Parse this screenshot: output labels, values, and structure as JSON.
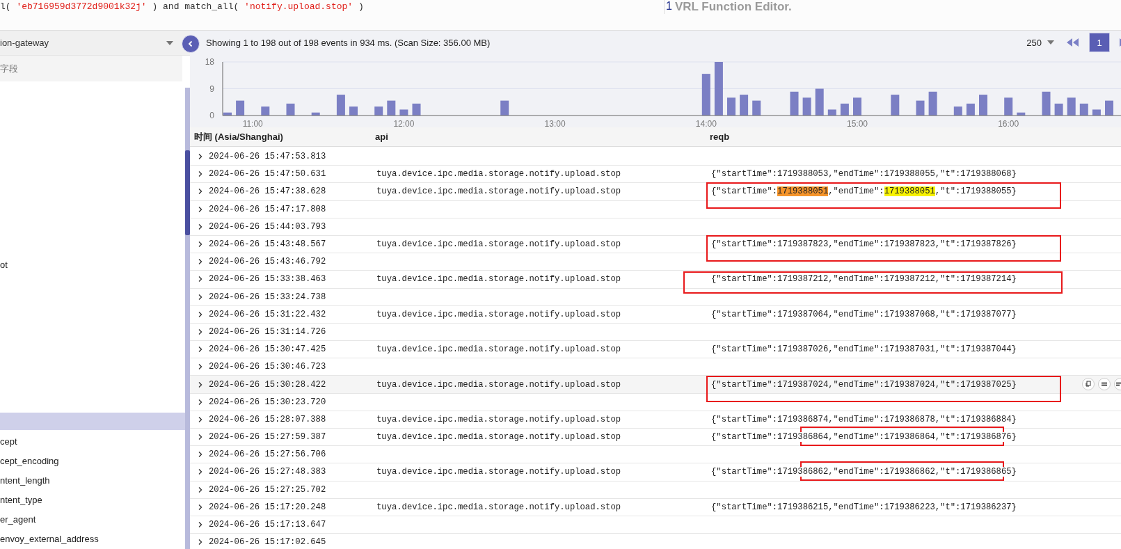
{
  "query_editor": {
    "parts": [
      {
        "kind": "code",
        "text": "l( "
      },
      {
        "kind": "string",
        "text": "'eb716959d3772d9001k32j'"
      },
      {
        "kind": "code",
        "text": " ) and match_all( "
      },
      {
        "kind": "string",
        "text": "'notify.upload.stop'"
      },
      {
        "kind": "code",
        "text": " )"
      }
    ]
  },
  "function_editor": {
    "line_number": "1",
    "text": "VRL Function Editor."
  },
  "sidebar": {
    "stream_select": {
      "value": "ion-gateway"
    },
    "field_search": {
      "placeholder": "字段"
    },
    "fields": [
      {
        "label": "ot",
        "selected": false
      },
      {
        "selected": true
      },
      {
        "label": "cept",
        "selected": false
      },
      {
        "label": "cept_encoding",
        "selected": false
      },
      {
        "label": "ntent_length",
        "selected": false
      },
      {
        "label": "ntent_type",
        "selected": false
      },
      {
        "label": "er_agent",
        "selected": false
      },
      {
        "label": "envoy_external_address",
        "selected": false
      }
    ]
  },
  "results": {
    "summary": "Showing 1 to 198 out of 198 events in 934 ms. (Scan Size: 356.00 MB)",
    "pagination": {
      "page_size": "250",
      "pages": [
        {
          "label": "1",
          "selected": true
        }
      ]
    },
    "histogram": {
      "chart_data": {
        "type": "bar",
        "categories": [
          null,
          null,
          "11:00",
          null,
          null,
          null,
          null,
          null,
          null,
          null,
          null,
          null,
          null,
          null,
          "12:00",
          null,
          null,
          null,
          null,
          null,
          null,
          null,
          null,
          null,
          null,
          null,
          "13:00",
          null,
          null,
          null,
          null,
          null,
          null,
          null,
          null,
          null,
          null,
          null,
          "14:00",
          null,
          null,
          null,
          null,
          null,
          null,
          null,
          null,
          null,
          null,
          null,
          "15:00",
          null,
          null,
          null,
          null,
          null,
          null,
          null,
          null,
          null,
          null,
          null,
          "16:00",
          null,
          null,
          null,
          null,
          null,
          null,
          null,
          null
        ],
        "values": [
          1,
          5,
          0,
          3,
          0,
          4,
          0,
          1,
          0,
          7,
          3,
          0,
          3,
          5,
          2,
          4,
          0,
          0,
          0,
          0,
          0,
          0,
          5,
          0,
          0,
          0,
          0,
          0,
          0,
          0,
          0,
          0,
          0,
          0,
          0,
          0,
          0,
          0,
          14,
          18,
          6,
          7,
          5,
          0,
          0,
          8,
          6,
          9,
          2,
          4,
          6,
          0,
          0,
          7,
          0,
          5,
          8,
          0,
          3,
          4,
          7,
          0,
          6,
          1,
          0,
          8,
          4,
          6,
          4,
          2,
          5
        ],
        "ylim": [
          0,
          18
        ],
        "yticks": [
          0,
          9,
          18
        ]
      }
    },
    "table": {
      "columns": [
        "时间 (Asia/Shanghai)",
        "api",
        "reqb"
      ],
      "rows": [
        {
          "time": "2024-06-26 15:47:53.813"
        },
        {
          "time": "2024-06-26 15:47:50.631",
          "api": "tuya.device.ipc.media.storage.notify.upload.stop",
          "reqb": "{\"startTime\":1719388053,\"endTime\":1719388055,\"t\":1719388068}"
        },
        {
          "time": "2024-06-26 15:47:38.628",
          "api": "tuya.device.ipc.media.storage.notify.upload.stop",
          "reqb_parts": [
            {
              "text": "{\"startTime\":"
            },
            {
              "text": "1719388051",
              "color": "#f5942a"
            },
            {
              "text": ",\"endTime\":"
            },
            {
              "text": "1719388051",
              "color": "#f7f200"
            },
            {
              "text": ",\"t\":1719388055}"
            }
          ],
          "annotation_box": {
            "kind": "full"
          }
        },
        {
          "time": "2024-06-26 15:47:17.808"
        },
        {
          "time": "2024-06-26 15:44:03.793"
        },
        {
          "time": "2024-06-26 15:43:48.567",
          "api": "tuya.device.ipc.media.storage.notify.upload.stop",
          "reqb": "{\"startTime\":1719387823,\"endTime\":1719387823,\"t\":1719387826}",
          "annotation_box": {
            "kind": "full"
          }
        },
        {
          "time": "2024-06-26 15:43:46.792"
        },
        {
          "time": "2024-06-26 15:33:38.463",
          "api": "tuya.device.ipc.media.storage.notify.upload.stop",
          "reqb": "{\"startTime\":1719387212,\"endTime\":1719387212,\"t\":1719387214}",
          "annotation_box": {
            "kind": "wide"
          }
        },
        {
          "time": "2024-06-26 15:33:24.738"
        },
        {
          "time": "2024-06-26 15:31:22.432",
          "api": "tuya.device.ipc.media.storage.notify.upload.stop",
          "reqb": "{\"startTime\":1719387064,\"endTime\":1719387068,\"t\":1719387077}"
        },
        {
          "time": "2024-06-26 15:31:14.726"
        },
        {
          "time": "2024-06-26 15:30:47.425",
          "api": "tuya.device.ipc.media.storage.notify.upload.stop",
          "reqb": "{\"startTime\":1719387026,\"endTime\":1719387031,\"t\":1719387044}"
        },
        {
          "time": "2024-06-26 15:30:46.723"
        },
        {
          "time": "2024-06-26 15:30:28.422",
          "api": "tuya.device.ipc.media.storage.notify.upload.stop",
          "reqb": "{\"startTime\":1719387024,\"endTime\":1719387024,\"t\":1719387025}",
          "annotation_box": {
            "kind": "full"
          },
          "hovered": true
        },
        {
          "time": "2024-06-26 15:30:23.720"
        },
        {
          "time": "2024-06-26 15:28:07.388",
          "api": "tuya.device.ipc.media.storage.notify.upload.stop",
          "reqb": "{\"startTime\":1719386874,\"endTime\":1719386878,\"t\":1719386884}"
        },
        {
          "time": "2024-06-26 15:27:59.387",
          "api": "tuya.device.ipc.media.storage.notify.upload.stop",
          "reqb": "{\"startTime\":1719386864,\"endTime\":1719386864,\"t\":1719386876}",
          "annotation_box": {
            "kind": "partial"
          }
        },
        {
          "time": "2024-06-26 15:27:56.706"
        },
        {
          "time": "2024-06-26 15:27:48.383",
          "api": "tuya.device.ipc.media.storage.notify.upload.stop",
          "reqb": "{\"startTime\":1719386862,\"endTime\":1719386862,\"t\":1719386865}",
          "annotation_box": {
            "kind": "partial"
          }
        },
        {
          "time": "2024-06-26 15:27:25.702"
        },
        {
          "time": "2024-06-26 15:17:20.248",
          "api": "tuya.device.ipc.media.storage.notify.upload.stop",
          "reqb": "{\"startTime\":1719386215,\"endTime\":1719386223,\"t\":1719386237}"
        },
        {
          "time": "2024-06-26 15:17:13.647"
        },
        {
          "time": "2024-06-26 15:17:02.645"
        }
      ]
    }
  }
}
